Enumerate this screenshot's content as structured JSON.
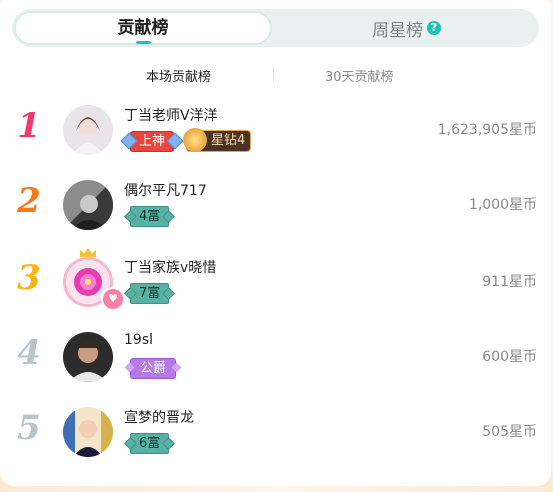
{
  "tabs": {
    "contribution": "贡献榜",
    "weekly_star": "周星榜",
    "help_icon": "?"
  },
  "subtabs": {
    "this_session": "本场贡献榜",
    "thirty_days": "30天贡献榜"
  },
  "ranking": [
    {
      "rank": "1",
      "name": "丁当老师V洋洋",
      "badges": [
        "上神",
        "星钻4"
      ],
      "score": "1,623,905星币"
    },
    {
      "rank": "2",
      "name": "偶尔平凡717",
      "badges": [
        "4富"
      ],
      "score": "1,000星币"
    },
    {
      "rank": "3",
      "name": "丁当家族v晓惜",
      "badges": [
        "7富"
      ],
      "score": "911星币"
    },
    {
      "rank": "4",
      "name": "19sl",
      "badges": [
        "公爵"
      ],
      "score": "600星币"
    },
    {
      "rank": "5",
      "name": "宣梦的晋龙",
      "badges": [
        "6富"
      ],
      "score": "505星币"
    }
  ],
  "colors": {
    "accent": "#18c6b2",
    "rank1": "#f0396e",
    "rank2": "#f37b1f",
    "rank3": "#f9b511",
    "rank_other": "#b7c5c9"
  }
}
